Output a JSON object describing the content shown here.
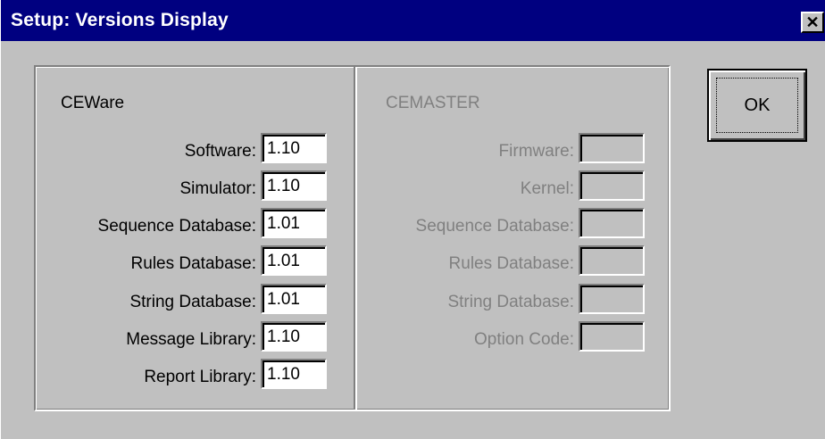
{
  "window": {
    "title": "Setup: Versions Display",
    "close_label": "✕"
  },
  "ceware": {
    "title": "CEWare",
    "fields": [
      {
        "label": "Software:",
        "value": "1.10"
      },
      {
        "label": "Simulator:",
        "value": "1.10"
      },
      {
        "label": "Sequence Database:",
        "value": "1.01"
      },
      {
        "label": "Rules Database:",
        "value": "1.01"
      },
      {
        "label": "String Database:",
        "value": "1.01"
      },
      {
        "label": "Message Library:",
        "value": "1.10"
      },
      {
        "label": "Report Library:",
        "value": "1.10"
      }
    ]
  },
  "cemaster": {
    "title": "CEMASTER",
    "disabled": true,
    "fields": [
      {
        "label": "Firmware:",
        "value": ""
      },
      {
        "label": "Kernel:",
        "value": ""
      },
      {
        "label": "Sequence Database:",
        "value": ""
      },
      {
        "label": "Rules Database:",
        "value": ""
      },
      {
        "label": "String Database:",
        "value": ""
      },
      {
        "label": "Option Code:",
        "value": ""
      }
    ]
  },
  "buttons": {
    "ok_label": "OK"
  },
  "colors": {
    "titlebar": "#000080",
    "face": "#c0c0c0",
    "disabled_text": "#808080"
  }
}
